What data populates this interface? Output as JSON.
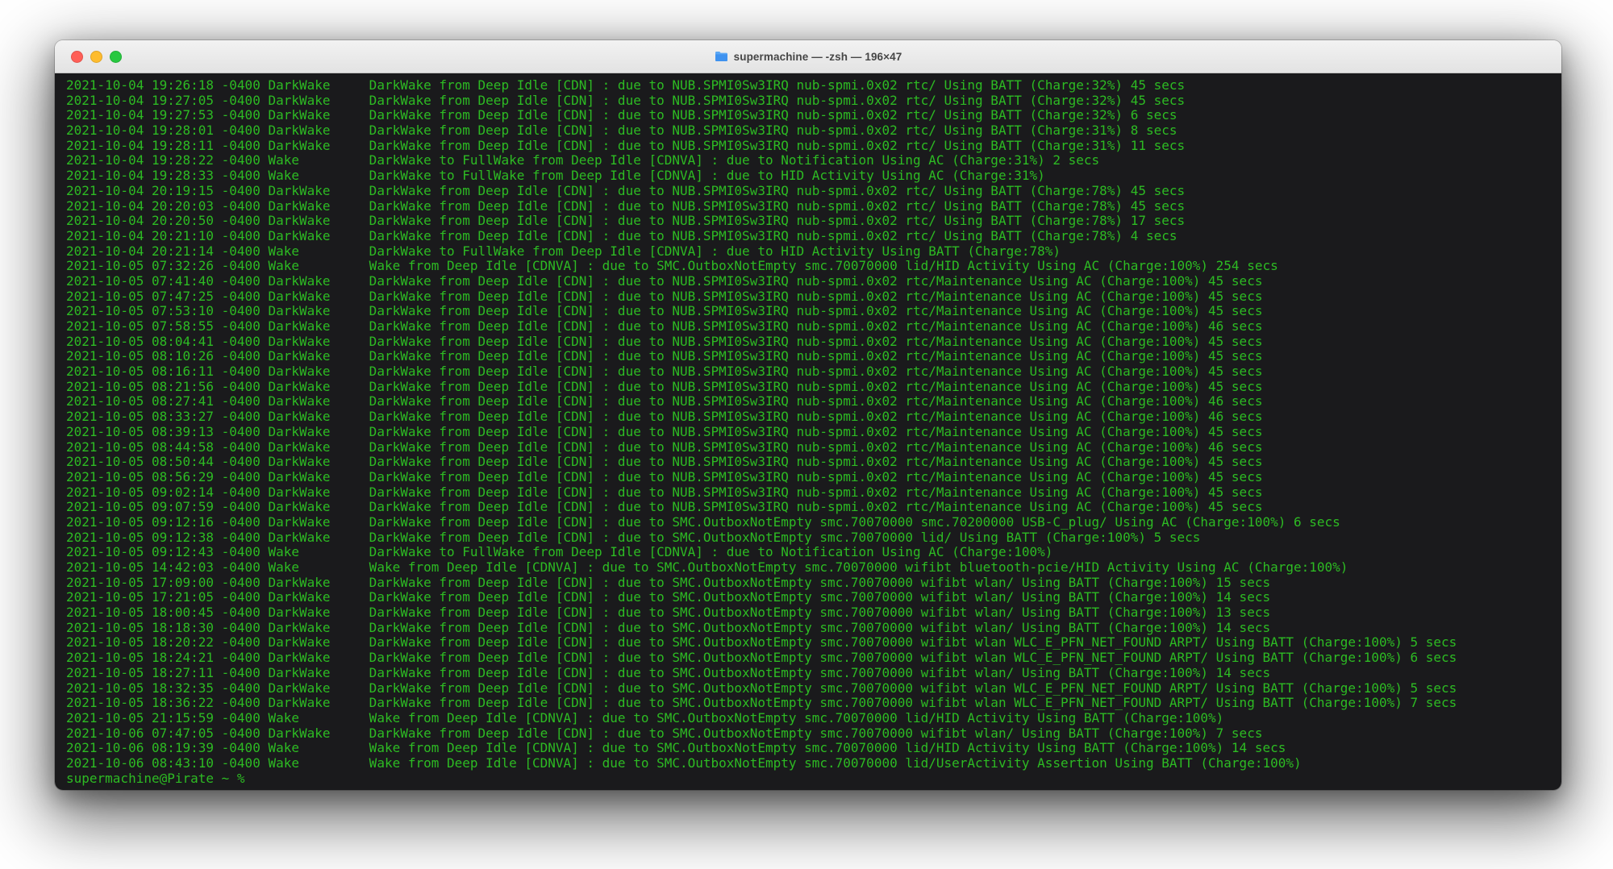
{
  "window": {
    "title": "supermachine — -zsh — 196×47",
    "controls": {
      "close": "close",
      "minimize": "minimize",
      "zoom": "zoom"
    },
    "proxy_icon": "folder-icon"
  },
  "colors": {
    "terminal_bg": "#1a1a1c",
    "terminal_text": "#2dbb23",
    "titlebar_bg": "#ececec",
    "titlebar_text": "#464646",
    "traffic_red": "#ff5f57",
    "traffic_yellow": "#febc2e",
    "traffic_green": "#28c840"
  },
  "terminal": {
    "prompt": "supermachine@Pirate ~ %",
    "entries": [
      {
        "date": "2021-10-04",
        "time": "19:26:18",
        "tz": "-0400",
        "type": "DarkWake",
        "msg": "DarkWake from Deep Idle [CDN] : due to NUB.SPMI0Sw3IRQ nub-spmi.0x02 rtc/ Using BATT (Charge:32%) 45 secs"
      },
      {
        "date": "2021-10-04",
        "time": "19:27:05",
        "tz": "-0400",
        "type": "DarkWake",
        "msg": "DarkWake from Deep Idle [CDN] : due to NUB.SPMI0Sw3IRQ nub-spmi.0x02 rtc/ Using BATT (Charge:32%) 45 secs"
      },
      {
        "date": "2021-10-04",
        "time": "19:27:53",
        "tz": "-0400",
        "type": "DarkWake",
        "msg": "DarkWake from Deep Idle [CDN] : due to NUB.SPMI0Sw3IRQ nub-spmi.0x02 rtc/ Using BATT (Charge:32%) 6 secs"
      },
      {
        "date": "2021-10-04",
        "time": "19:28:01",
        "tz": "-0400",
        "type": "DarkWake",
        "msg": "DarkWake from Deep Idle [CDN] : due to NUB.SPMI0Sw3IRQ nub-spmi.0x02 rtc/ Using BATT (Charge:31%) 8 secs"
      },
      {
        "date": "2021-10-04",
        "time": "19:28:11",
        "tz": "-0400",
        "type": "DarkWake",
        "msg": "DarkWake from Deep Idle [CDN] : due to NUB.SPMI0Sw3IRQ nub-spmi.0x02 rtc/ Using BATT (Charge:31%) 11 secs"
      },
      {
        "date": "2021-10-04",
        "time": "19:28:22",
        "tz": "-0400",
        "type": "Wake",
        "msg": "DarkWake to FullWake from Deep Idle [CDNVA] : due to Notification Using AC (Charge:31%) 2 secs"
      },
      {
        "date": "2021-10-04",
        "time": "19:28:33",
        "tz": "-0400",
        "type": "Wake",
        "msg": "DarkWake to FullWake from Deep Idle [CDNVA] : due to HID Activity Using AC (Charge:31%)"
      },
      {
        "date": "2021-10-04",
        "time": "20:19:15",
        "tz": "-0400",
        "type": "DarkWake",
        "msg": "DarkWake from Deep Idle [CDN] : due to NUB.SPMI0Sw3IRQ nub-spmi.0x02 rtc/ Using BATT (Charge:78%) 45 secs"
      },
      {
        "date": "2021-10-04",
        "time": "20:20:03",
        "tz": "-0400",
        "type": "DarkWake",
        "msg": "DarkWake from Deep Idle [CDN] : due to NUB.SPMI0Sw3IRQ nub-spmi.0x02 rtc/ Using BATT (Charge:78%) 45 secs"
      },
      {
        "date": "2021-10-04",
        "time": "20:20:50",
        "tz": "-0400",
        "type": "DarkWake",
        "msg": "DarkWake from Deep Idle [CDN] : due to NUB.SPMI0Sw3IRQ nub-spmi.0x02 rtc/ Using BATT (Charge:78%) 17 secs"
      },
      {
        "date": "2021-10-04",
        "time": "20:21:10",
        "tz": "-0400",
        "type": "DarkWake",
        "msg": "DarkWake from Deep Idle [CDN] : due to NUB.SPMI0Sw3IRQ nub-spmi.0x02 rtc/ Using BATT (Charge:78%) 4 secs"
      },
      {
        "date": "2021-10-04",
        "time": "20:21:14",
        "tz": "-0400",
        "type": "Wake",
        "msg": "DarkWake to FullWake from Deep Idle [CDNVA] : due to HID Activity Using BATT (Charge:78%)"
      },
      {
        "date": "2021-10-05",
        "time": "07:32:26",
        "tz": "-0400",
        "type": "Wake",
        "msg": "Wake from Deep Idle [CDNVA] : due to SMC.OutboxNotEmpty smc.70070000 lid/HID Activity Using AC (Charge:100%) 254 secs"
      },
      {
        "date": "2021-10-05",
        "time": "07:41:40",
        "tz": "-0400",
        "type": "DarkWake",
        "msg": "DarkWake from Deep Idle [CDN] : due to NUB.SPMI0Sw3IRQ nub-spmi.0x02 rtc/Maintenance Using AC (Charge:100%) 45 secs"
      },
      {
        "date": "2021-10-05",
        "time": "07:47:25",
        "tz": "-0400",
        "type": "DarkWake",
        "msg": "DarkWake from Deep Idle [CDN] : due to NUB.SPMI0Sw3IRQ nub-spmi.0x02 rtc/Maintenance Using AC (Charge:100%) 45 secs"
      },
      {
        "date": "2021-10-05",
        "time": "07:53:10",
        "tz": "-0400",
        "type": "DarkWake",
        "msg": "DarkWake from Deep Idle [CDN] : due to NUB.SPMI0Sw3IRQ nub-spmi.0x02 rtc/Maintenance Using AC (Charge:100%) 45 secs"
      },
      {
        "date": "2021-10-05",
        "time": "07:58:55",
        "tz": "-0400",
        "type": "DarkWake",
        "msg": "DarkWake from Deep Idle [CDN] : due to NUB.SPMI0Sw3IRQ nub-spmi.0x02 rtc/Maintenance Using AC (Charge:100%) 46 secs"
      },
      {
        "date": "2021-10-05",
        "time": "08:04:41",
        "tz": "-0400",
        "type": "DarkWake",
        "msg": "DarkWake from Deep Idle [CDN] : due to NUB.SPMI0Sw3IRQ nub-spmi.0x02 rtc/Maintenance Using AC (Charge:100%) 45 secs"
      },
      {
        "date": "2021-10-05",
        "time": "08:10:26",
        "tz": "-0400",
        "type": "DarkWake",
        "msg": "DarkWake from Deep Idle [CDN] : due to NUB.SPMI0Sw3IRQ nub-spmi.0x02 rtc/Maintenance Using AC (Charge:100%) 45 secs"
      },
      {
        "date": "2021-10-05",
        "time": "08:16:11",
        "tz": "-0400",
        "type": "DarkWake",
        "msg": "DarkWake from Deep Idle [CDN] : due to NUB.SPMI0Sw3IRQ nub-spmi.0x02 rtc/Maintenance Using AC (Charge:100%) 45 secs"
      },
      {
        "date": "2021-10-05",
        "time": "08:21:56",
        "tz": "-0400",
        "type": "DarkWake",
        "msg": "DarkWake from Deep Idle [CDN] : due to NUB.SPMI0Sw3IRQ nub-spmi.0x02 rtc/Maintenance Using AC (Charge:100%) 45 secs"
      },
      {
        "date": "2021-10-05",
        "time": "08:27:41",
        "tz": "-0400",
        "type": "DarkWake",
        "msg": "DarkWake from Deep Idle [CDN] : due to NUB.SPMI0Sw3IRQ nub-spmi.0x02 rtc/Maintenance Using AC (Charge:100%) 46 secs"
      },
      {
        "date": "2021-10-05",
        "time": "08:33:27",
        "tz": "-0400",
        "type": "DarkWake",
        "msg": "DarkWake from Deep Idle [CDN] : due to NUB.SPMI0Sw3IRQ nub-spmi.0x02 rtc/Maintenance Using AC (Charge:100%) 46 secs"
      },
      {
        "date": "2021-10-05",
        "time": "08:39:13",
        "tz": "-0400",
        "type": "DarkWake",
        "msg": "DarkWake from Deep Idle [CDN] : due to NUB.SPMI0Sw3IRQ nub-spmi.0x02 rtc/Maintenance Using AC (Charge:100%) 45 secs"
      },
      {
        "date": "2021-10-05",
        "time": "08:44:58",
        "tz": "-0400",
        "type": "DarkWake",
        "msg": "DarkWake from Deep Idle [CDN] : due to NUB.SPMI0Sw3IRQ nub-spmi.0x02 rtc/Maintenance Using AC (Charge:100%) 46 secs"
      },
      {
        "date": "2021-10-05",
        "time": "08:50:44",
        "tz": "-0400",
        "type": "DarkWake",
        "msg": "DarkWake from Deep Idle [CDN] : due to NUB.SPMI0Sw3IRQ nub-spmi.0x02 rtc/Maintenance Using AC (Charge:100%) 45 secs"
      },
      {
        "date": "2021-10-05",
        "time": "08:56:29",
        "tz": "-0400",
        "type": "DarkWake",
        "msg": "DarkWake from Deep Idle [CDN] : due to NUB.SPMI0Sw3IRQ nub-spmi.0x02 rtc/Maintenance Using AC (Charge:100%) 45 secs"
      },
      {
        "date": "2021-10-05",
        "time": "09:02:14",
        "tz": "-0400",
        "type": "DarkWake",
        "msg": "DarkWake from Deep Idle [CDN] : due to NUB.SPMI0Sw3IRQ nub-spmi.0x02 rtc/Maintenance Using AC (Charge:100%) 45 secs"
      },
      {
        "date": "2021-10-05",
        "time": "09:07:59",
        "tz": "-0400",
        "type": "DarkWake",
        "msg": "DarkWake from Deep Idle [CDN] : due to NUB.SPMI0Sw3IRQ nub-spmi.0x02 rtc/Maintenance Using AC (Charge:100%) 45 secs"
      },
      {
        "date": "2021-10-05",
        "time": "09:12:16",
        "tz": "-0400",
        "type": "DarkWake",
        "msg": "DarkWake from Deep Idle [CDN] : due to SMC.OutboxNotEmpty smc.70070000 smc.70200000 USB-C_plug/ Using AC (Charge:100%) 6 secs"
      },
      {
        "date": "2021-10-05",
        "time": "09:12:38",
        "tz": "-0400",
        "type": "DarkWake",
        "msg": "DarkWake from Deep Idle [CDN] : due to SMC.OutboxNotEmpty smc.70070000 lid/ Using BATT (Charge:100%) 5 secs"
      },
      {
        "date": "2021-10-05",
        "time": "09:12:43",
        "tz": "-0400",
        "type": "Wake",
        "msg": "DarkWake to FullWake from Deep Idle [CDNVA] : due to Notification Using AC (Charge:100%)"
      },
      {
        "date": "2021-10-05",
        "time": "14:42:03",
        "tz": "-0400",
        "type": "Wake",
        "msg": "Wake from Deep Idle [CDNVA] : due to SMC.OutboxNotEmpty smc.70070000 wifibt bluetooth-pcie/HID Activity Using AC (Charge:100%)"
      },
      {
        "date": "2021-10-05",
        "time": "17:09:00",
        "tz": "-0400",
        "type": "DarkWake",
        "msg": "DarkWake from Deep Idle [CDN] : due to SMC.OutboxNotEmpty smc.70070000 wifibt wlan/ Using BATT (Charge:100%) 15 secs"
      },
      {
        "date": "2021-10-05",
        "time": "17:21:05",
        "tz": "-0400",
        "type": "DarkWake",
        "msg": "DarkWake from Deep Idle [CDN] : due to SMC.OutboxNotEmpty smc.70070000 wifibt wlan/ Using BATT (Charge:100%) 14 secs"
      },
      {
        "date": "2021-10-05",
        "time": "18:00:45",
        "tz": "-0400",
        "type": "DarkWake",
        "msg": "DarkWake from Deep Idle [CDN] : due to SMC.OutboxNotEmpty smc.70070000 wifibt wlan/ Using BATT (Charge:100%) 13 secs"
      },
      {
        "date": "2021-10-05",
        "time": "18:18:30",
        "tz": "-0400",
        "type": "DarkWake",
        "msg": "DarkWake from Deep Idle [CDN] : due to SMC.OutboxNotEmpty smc.70070000 wifibt wlan/ Using BATT (Charge:100%) 14 secs"
      },
      {
        "date": "2021-10-05",
        "time": "18:20:22",
        "tz": "-0400",
        "type": "DarkWake",
        "msg": "DarkWake from Deep Idle [CDN] : due to SMC.OutboxNotEmpty smc.70070000 wifibt wlan WLC_E_PFN_NET_FOUND ARPT/ Using BATT (Charge:100%) 5 secs"
      },
      {
        "date": "2021-10-05",
        "time": "18:24:21",
        "tz": "-0400",
        "type": "DarkWake",
        "msg": "DarkWake from Deep Idle [CDN] : due to SMC.OutboxNotEmpty smc.70070000 wifibt wlan WLC_E_PFN_NET_FOUND ARPT/ Using BATT (Charge:100%) 6 secs"
      },
      {
        "date": "2021-10-05",
        "time": "18:27:11",
        "tz": "-0400",
        "type": "DarkWake",
        "msg": "DarkWake from Deep Idle [CDN] : due to SMC.OutboxNotEmpty smc.70070000 wifibt wlan/ Using BATT (Charge:100%) 14 secs"
      },
      {
        "date": "2021-10-05",
        "time": "18:32:35",
        "tz": "-0400",
        "type": "DarkWake",
        "msg": "DarkWake from Deep Idle [CDN] : due to SMC.OutboxNotEmpty smc.70070000 wifibt wlan WLC_E_PFN_NET_FOUND ARPT/ Using BATT (Charge:100%) 5 secs"
      },
      {
        "date": "2021-10-05",
        "time": "18:36:22",
        "tz": "-0400",
        "type": "DarkWake",
        "msg": "DarkWake from Deep Idle [CDN] : due to SMC.OutboxNotEmpty smc.70070000 wifibt wlan WLC_E_PFN_NET_FOUND ARPT/ Using BATT (Charge:100%) 7 secs"
      },
      {
        "date": "2021-10-05",
        "time": "21:15:59",
        "tz": "-0400",
        "type": "Wake",
        "msg": "Wake from Deep Idle [CDNVA] : due to SMC.OutboxNotEmpty smc.70070000 lid/HID Activity Using BATT (Charge:100%)"
      },
      {
        "date": "2021-10-06",
        "time": "07:47:05",
        "tz": "-0400",
        "type": "DarkWake",
        "msg": "DarkWake from Deep Idle [CDN] : due to SMC.OutboxNotEmpty smc.70070000 wifibt wlan/ Using BATT (Charge:100%) 7 secs"
      },
      {
        "date": "2021-10-06",
        "time": "08:19:39",
        "tz": "-0400",
        "type": "Wake",
        "msg": "Wake from Deep Idle [CDNVA] : due to SMC.OutboxNotEmpty smc.70070000 lid/HID Activity Using BATT (Charge:100%) 14 secs"
      },
      {
        "date": "2021-10-06",
        "time": "08:43:10",
        "tz": "-0400",
        "type": "Wake",
        "msg": "Wake from Deep Idle [CDNVA] : due to SMC.OutboxNotEmpty smc.70070000 lid/UserActivity Assertion Using BATT (Charge:100%)"
      }
    ]
  }
}
